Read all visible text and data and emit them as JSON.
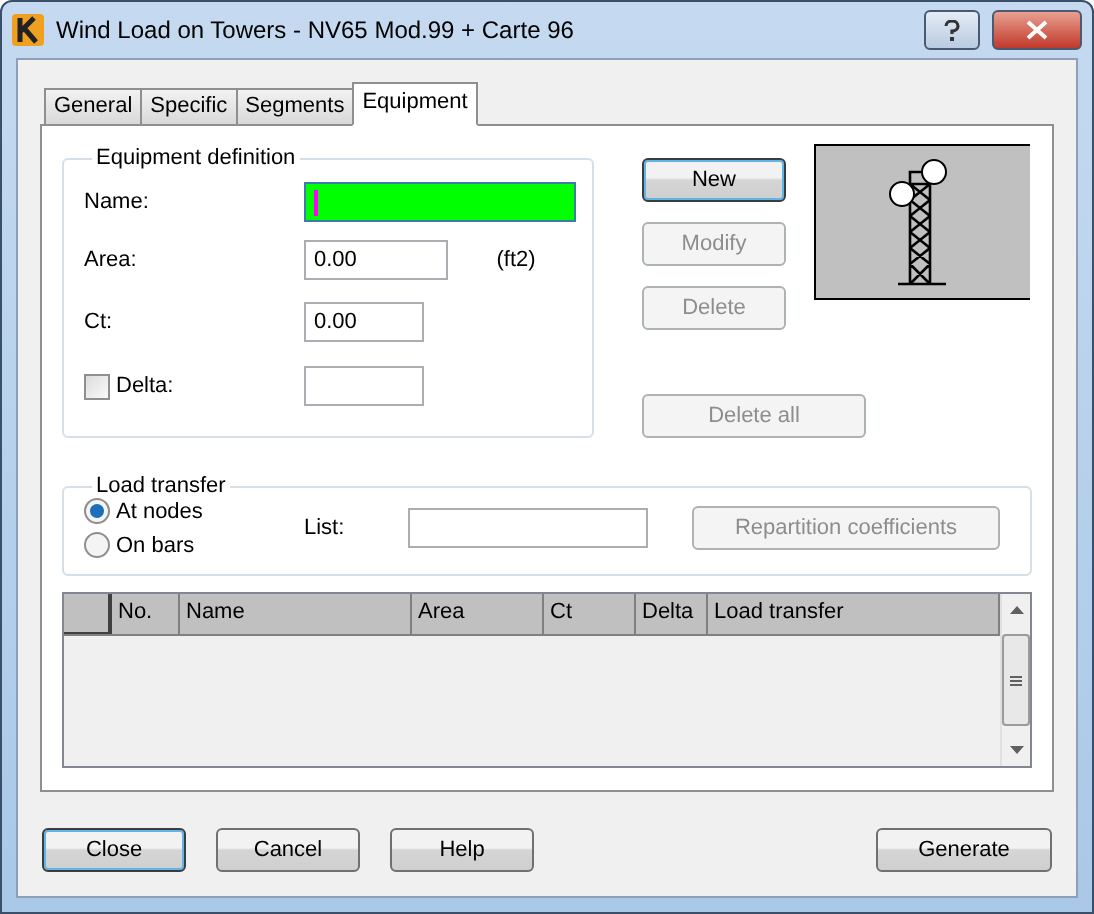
{
  "window": {
    "title": "Wind Load on Towers - NV65 Mod.99 + Carte 96"
  },
  "tabs": [
    {
      "label": "General",
      "selected": false
    },
    {
      "label": "Specific",
      "selected": false
    },
    {
      "label": "Segments",
      "selected": false
    },
    {
      "label": "Equipment",
      "selected": true
    }
  ],
  "equipment_definition": {
    "title": "Equipment definition",
    "fields": [
      {
        "kind": "text",
        "label": "Name:",
        "color": "#00ff00",
        "focused": true
      },
      {
        "kind": "text",
        "label": "Area:",
        "value": "0.00",
        "unit": "(ft2)"
      },
      {
        "kind": "text",
        "label": "Ct:",
        "value": "0.00"
      },
      {
        "kind": "checkbox",
        "label": "Delta:",
        "checked": false
      }
    ]
  },
  "equipment_buttons": [
    {
      "label": "New",
      "disabled": false,
      "default": true
    },
    {
      "label": "Modify",
      "disabled": true,
      "default": false
    },
    {
      "label": "Delete",
      "disabled": true,
      "default": false
    },
    {
      "label": "Delete all",
      "disabled": true,
      "default": false
    }
  ],
  "load_transfer": {
    "title": "Load transfer",
    "options": [
      {
        "label": "At nodes",
        "selected": true
      },
      {
        "label": "On bars",
        "selected": false
      }
    ],
    "list_label": "List:",
    "button": {
      "label": "Repartition coefficients",
      "disabled": true
    }
  },
  "table": {
    "columns": [
      "No.",
      "Name",
      "Area",
      "Ct",
      "Delta",
      "Load transfer"
    ]
  },
  "footer_buttons": [
    {
      "label": "Close",
      "default": true
    },
    {
      "label": "Cancel",
      "default": false
    },
    {
      "label": "Help",
      "default": false
    },
    {
      "label": "Generate",
      "default": false
    }
  ]
}
